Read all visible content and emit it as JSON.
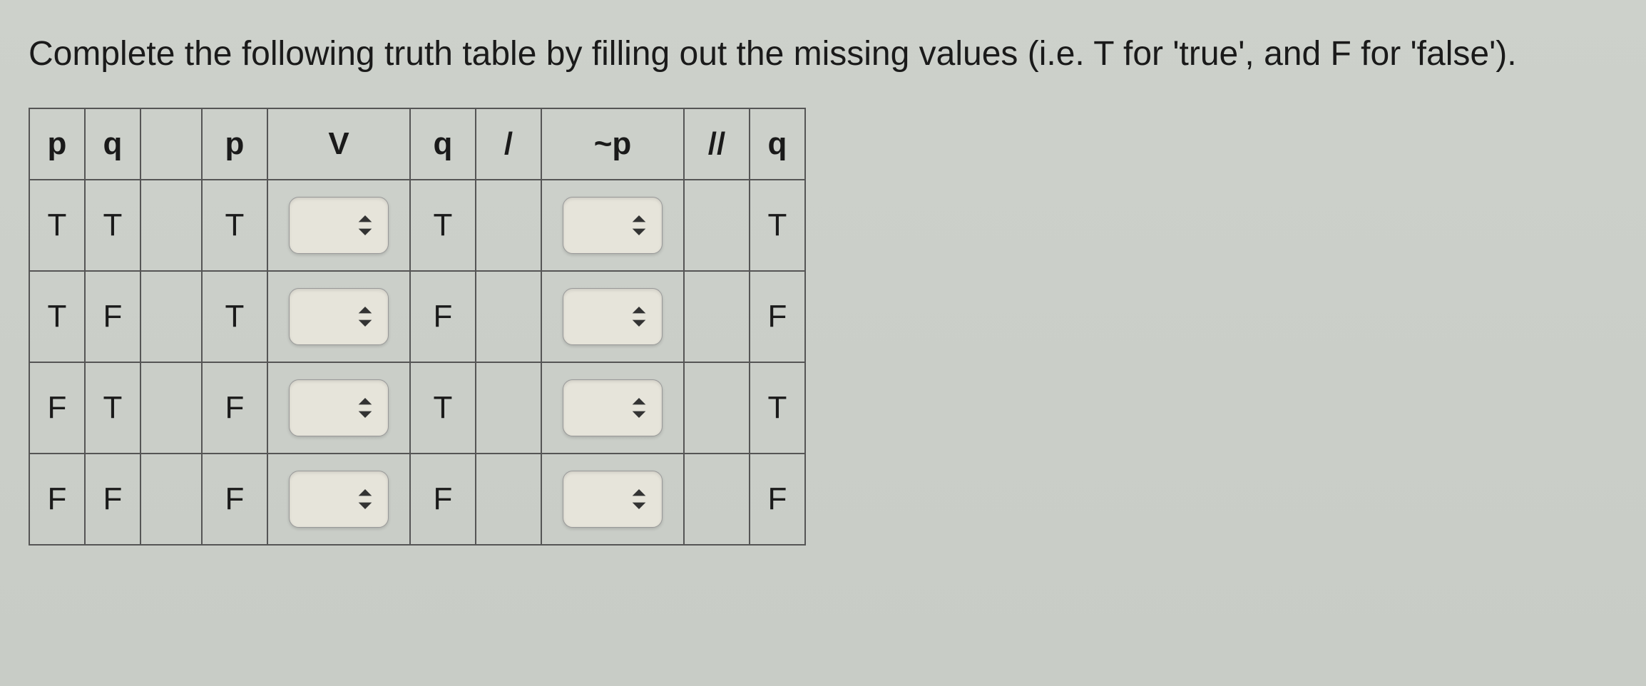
{
  "instructions": "Complete the following truth table by filling out the missing values (i.e. T for 'true', and F for 'false').",
  "headers": {
    "p1": "p",
    "q1": "q",
    "p2": "p",
    "v": "V",
    "q2": "q",
    "slash": "/",
    "notp": "~p",
    "dblslash": "//",
    "q3": "q"
  },
  "rows": [
    {
      "p": "T",
      "q": "T",
      "p2": "T",
      "v": "",
      "q2": "T",
      "notp": "",
      "q3": "T"
    },
    {
      "p": "T",
      "q": "F",
      "p2": "T",
      "v": "",
      "q2": "F",
      "notp": "",
      "q3": "F"
    },
    {
      "p": "F",
      "q": "T",
      "p2": "F",
      "v": "",
      "q2": "T",
      "notp": "",
      "q3": "T"
    },
    {
      "p": "F",
      "q": "F",
      "p2": "F",
      "v": "",
      "q2": "F",
      "notp": "",
      "q3": "F"
    }
  ]
}
